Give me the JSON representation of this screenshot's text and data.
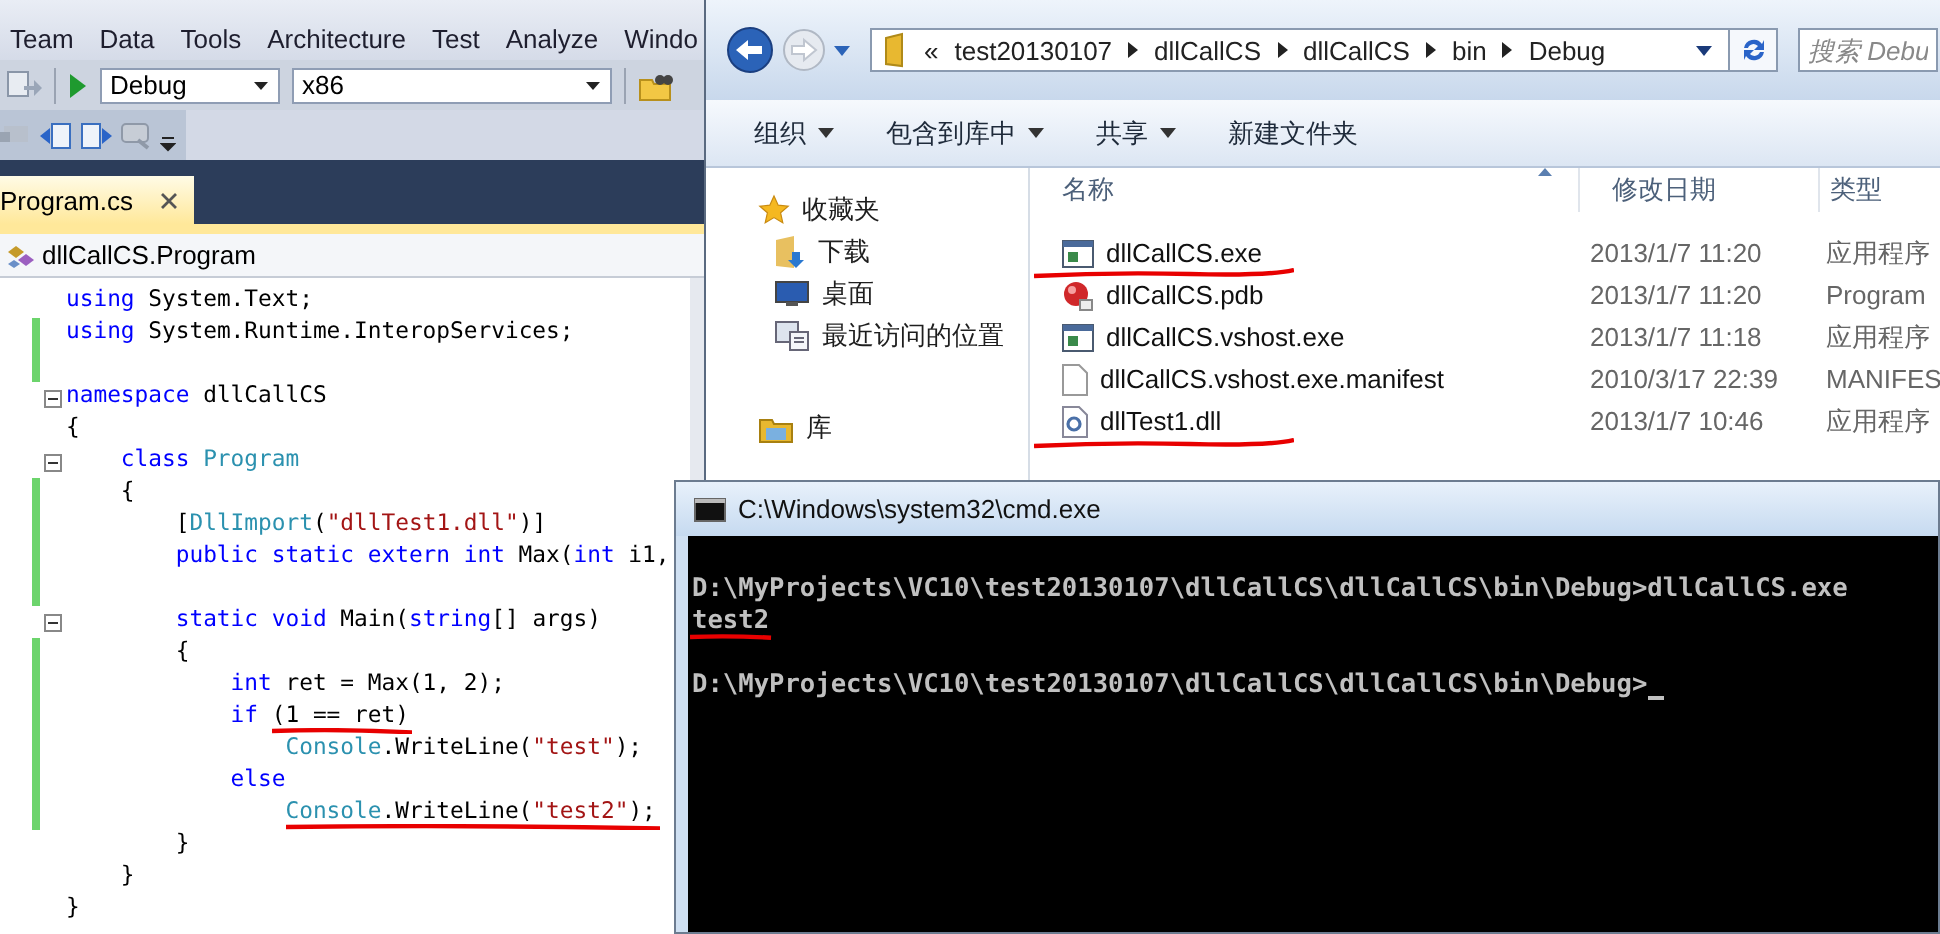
{
  "ide": {
    "menu": [
      "Team",
      "Data",
      "Tools",
      "Architecture",
      "Test",
      "Analyze",
      "Windo"
    ],
    "configuration": "Debug",
    "platform": "x86",
    "tab": {
      "label": "Program.cs",
      "selected": true
    },
    "nav": "dllCallCS.Program",
    "code": [
      {
        "changed": false,
        "collapsible": false,
        "segments": [
          {
            "text": "using",
            "kind": "kw"
          },
          {
            "text": " System.Text;",
            "kind": "plain"
          }
        ]
      },
      {
        "changed": true,
        "collapsible": false,
        "segments": [
          {
            "text": "using",
            "kind": "kw"
          },
          {
            "text": " System.Runtime.InteropServices;",
            "kind": "plain"
          }
        ]
      },
      {
        "changed": true,
        "collapsible": false
      },
      {
        "changed": false,
        "collapsible": true,
        "segments": [
          {
            "text": "namespace",
            "kind": "kw"
          },
          {
            "text": " dllCallCS",
            "kind": "plain"
          }
        ]
      },
      {
        "changed": false,
        "collapsible": false,
        "segments": [
          {
            "text": "{",
            "kind": "plain"
          }
        ]
      },
      {
        "changed": false,
        "collapsible": true,
        "segments": [
          {
            "text": "    class ",
            "kind": "kw"
          },
          {
            "text": "Program",
            "kind": "type"
          }
        ]
      },
      {
        "changed": true,
        "collapsible": false,
        "segments": [
          {
            "text": "    {",
            "kind": "plain"
          }
        ]
      },
      {
        "changed": true,
        "collapsible": false,
        "segments": [
          {
            "text": "        [",
            "kind": "plain"
          },
          {
            "text": "DllImport",
            "kind": "type"
          },
          {
            "text": "(",
            "kind": "plain"
          },
          {
            "text": "\"dllTest1.dll\"",
            "kind": "str"
          },
          {
            "text": ")]",
            "kind": "plain"
          }
        ]
      },
      {
        "changed": true,
        "collapsible": false,
        "segments": [
          {
            "text": "        public static extern int",
            "kind": "kw"
          },
          {
            "text": " Max(",
            "kind": "plain"
          },
          {
            "text": "int",
            "kind": "kw"
          },
          {
            "text": " i1,",
            "kind": "plain"
          }
        ]
      },
      {
        "changed": true,
        "collapsible": false
      },
      {
        "changed": false,
        "collapsible": true,
        "segments": [
          {
            "text": "        static void",
            "kind": "kw"
          },
          {
            "text": " Main(",
            "kind": "plain"
          },
          {
            "text": "string",
            "kind": "kw"
          },
          {
            "text": "[] args)",
            "kind": "plain"
          }
        ]
      },
      {
        "changed": true,
        "collapsible": false,
        "segments": [
          {
            "text": "        {",
            "kind": "plain"
          }
        ]
      },
      {
        "changed": true,
        "collapsible": false,
        "segments": [
          {
            "text": "            int",
            "kind": "kw"
          },
          {
            "text": " ret = Max(1, 2);",
            "kind": "plain"
          }
        ]
      },
      {
        "changed": true,
        "collapsible": false,
        "segments": [
          {
            "text": "            if",
            "kind": "kw"
          },
          {
            "text": " (1 == ret)",
            "kind": "plain",
            "marked": true
          }
        ]
      },
      {
        "changed": true,
        "collapsible": false,
        "segments": [
          {
            "text": "                Console",
            "kind": "type"
          },
          {
            "text": ".WriteLine(",
            "kind": "plain"
          },
          {
            "text": "\"test\"",
            "kind": "str"
          },
          {
            "text": ");",
            "kind": "plain"
          }
        ]
      },
      {
        "changed": true,
        "collapsible": false,
        "segments": [
          {
            "text": "            else",
            "kind": "kw"
          }
        ]
      },
      {
        "changed": true,
        "collapsible": false,
        "segments": [
          {
            "text": "                Console",
            "kind": "type",
            "marked": true
          },
          {
            "text": ".WriteLine(",
            "kind": "plain",
            "marked": true
          },
          {
            "text": "\"test2\"",
            "kind": "str",
            "marked": true
          },
          {
            "text": ");",
            "kind": "plain",
            "marked": true
          }
        ]
      },
      {
        "changed": false,
        "collapsible": false,
        "segments": [
          {
            "text": "        }",
            "kind": "plain"
          }
        ]
      },
      {
        "changed": false,
        "collapsible": false,
        "segments": [
          {
            "text": "    }",
            "kind": "plain"
          }
        ]
      },
      {
        "changed": false,
        "collapsible": false,
        "segments": [
          {
            "text": "}",
            "kind": "plain"
          }
        ]
      }
    ]
  },
  "explorer": {
    "overflow": "«",
    "breadcrumb": [
      "test20130107",
      "dllCallCS",
      "dllCallCS",
      "bin",
      "Debug"
    ],
    "search": {
      "placeholder": "搜索 Debu"
    },
    "commands": [
      {
        "label": "组织",
        "dropdown": true
      },
      {
        "label": "包含到库中",
        "dropdown": true
      },
      {
        "label": "共享",
        "dropdown": true
      },
      {
        "label": "新建文件夹",
        "dropdown": false
      }
    ],
    "sidebar": [
      {
        "label": "收藏夹",
        "kind": "favorites"
      },
      {
        "label": "下载",
        "kind": "downloads"
      },
      {
        "label": "桌面",
        "kind": "desktop"
      },
      {
        "label": "最近访问的位置",
        "kind": "recent"
      },
      {
        "label": "库",
        "kind": "library"
      }
    ],
    "columns": [
      "名称",
      "修改日期",
      "类型"
    ],
    "files": [
      {
        "name": "dllCallCS.exe",
        "modified": "2013/1/7 11:20",
        "type": "应用程序",
        "kind": "exe",
        "marked": true
      },
      {
        "name": "dllCallCS.pdb",
        "modified": "2013/1/7 11:20",
        "type": "Program",
        "kind": "pdb",
        "marked": false
      },
      {
        "name": "dllCallCS.vshost.exe",
        "modified": "2013/1/7 11:18",
        "type": "应用程序",
        "kind": "exe",
        "marked": false
      },
      {
        "name": "dllCallCS.vshost.exe.manifest",
        "modified": "2010/3/17 22:39",
        "type": "MANIFES",
        "kind": "manifest",
        "marked": false
      },
      {
        "name": "dllTest1.dll",
        "modified": "2013/1/7 10:46",
        "type": "应用程序",
        "kind": "dll",
        "marked": true
      }
    ]
  },
  "console": {
    "title": "C:\\Windows\\system32\\cmd.exe",
    "lines": [
      {
        "cursor": false,
        "marked": false
      },
      {
        "text": "D:\\MyProjects\\VC10\\test20130107\\dllCallCS\\dllCallCS\\bin\\Debug>dllCallCS.exe",
        "cursor": false,
        "marked": false
      },
      {
        "text": "test2",
        "cursor": false,
        "marked": true
      },
      {
        "cursor": false,
        "marked": false
      },
      {
        "text": "D:\\MyProjects\\VC10\\test20130107\\dllCallCS\\dllCallCS\\bin\\Debug>",
        "cursor": true,
        "marked": false
      }
    ]
  }
}
